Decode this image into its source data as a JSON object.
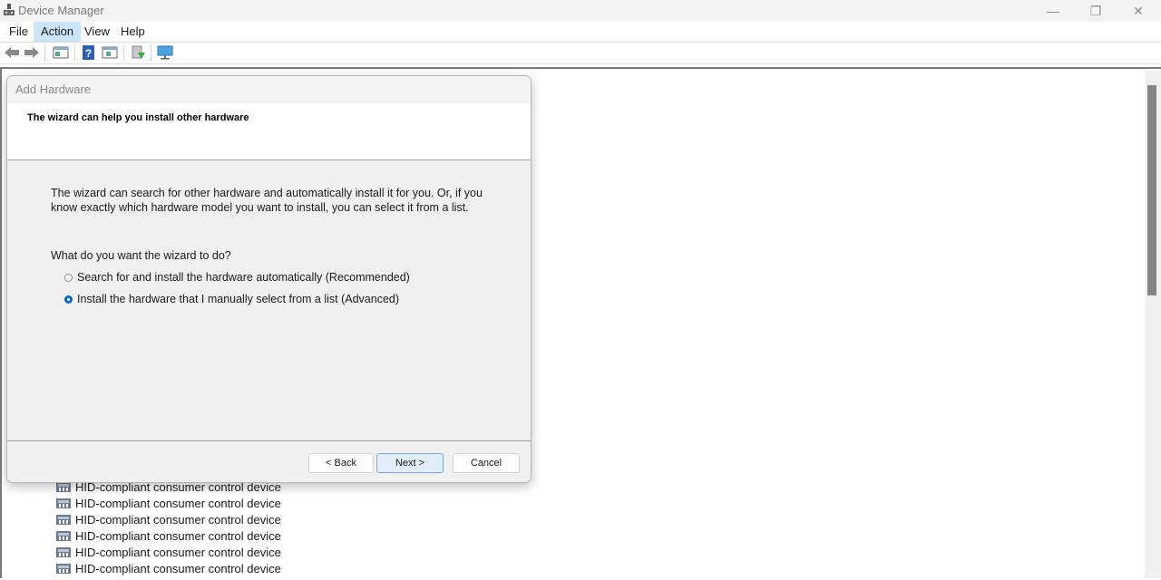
{
  "window": {
    "title": "Device Manager",
    "controls": {
      "minimize": "—",
      "restore": "❐",
      "close": "✕"
    }
  },
  "menubar": {
    "items": [
      {
        "label": "File"
      },
      {
        "label": "Action",
        "active": true
      },
      {
        "label": "View"
      },
      {
        "label": "Help"
      }
    ]
  },
  "toolbar": {
    "icons": [
      "back-arrow-icon",
      "forward-arrow-icon",
      "show-hide-console-tree-icon",
      "help-icon",
      "show-action-pane-icon",
      "update-driver-icon",
      "scan-hardware-changes-icon"
    ]
  },
  "device_tree": {
    "items": [
      {
        "label": "HID-compliant consumer control device"
      },
      {
        "label": "HID-compliant consumer control device"
      },
      {
        "label": "HID-compliant consumer control device"
      },
      {
        "label": "HID-compliant consumer control device"
      },
      {
        "label": "HID-compliant consumer control device"
      },
      {
        "label": "HID-compliant consumer control device"
      }
    ]
  },
  "dialog": {
    "title": "Add Hardware",
    "heading": "The wizard can help you install other hardware",
    "description": "The wizard can search for other hardware and automatically install it for you. Or, if you know exactly which hardware model you want to install, you can select it from a list.",
    "question": "What do you want the wizard to do?",
    "options": [
      {
        "label": "Search for and install the hardware automatically (Recommended)",
        "checked": false
      },
      {
        "label": "Install the hardware that I manually select from a list (Advanced)",
        "checked": true
      }
    ],
    "buttons": {
      "back": "< Back",
      "next": "Next >",
      "cancel": "Cancel"
    }
  }
}
